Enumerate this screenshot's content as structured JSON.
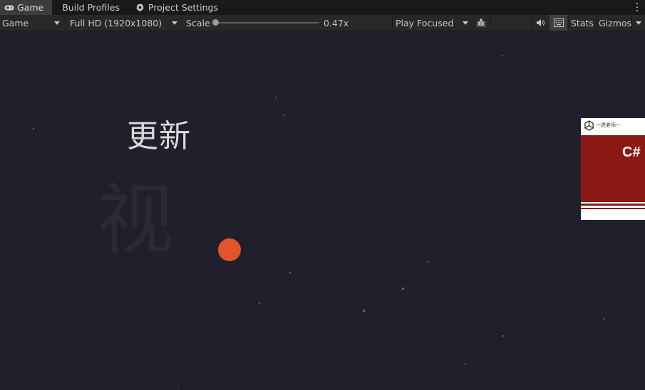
{
  "tabs": [
    {
      "label": "Game",
      "icon": "gamepad-icon",
      "active": true
    },
    {
      "label": "Build Profiles",
      "active": false
    },
    {
      "label": "Project Settings",
      "icon": "gear-icon",
      "active": false
    }
  ],
  "toolbar": {
    "display": "Game",
    "resolution": "Full HD (1920x1080)",
    "scale_label": "Scale",
    "scale_value": "0.47x",
    "scale_fraction": 0.0,
    "play_mode": "Play Focused",
    "stats_label": "Stats",
    "gizmos_label": "Gizmos"
  },
  "game": {
    "title_text": "更新",
    "ghost_text": "视",
    "ball_color": "#e3542c",
    "background_color": "#221f2c",
    "thumbnail": {
      "header_text": "一虎老师一",
      "big_text": "C#",
      "accent_color": "#8a1813"
    }
  }
}
